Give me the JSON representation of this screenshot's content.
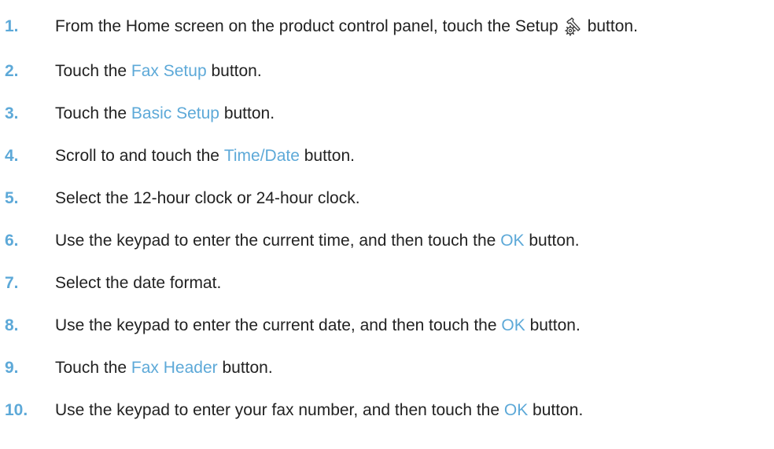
{
  "colors": {
    "step_number": "#5da9d8",
    "ui_label": "#5da9d8",
    "body_text": "#222222"
  },
  "steps": [
    {
      "number": "1.",
      "parts": [
        "From the Home screen on the product control panel, touch the Setup",
        "button."
      ],
      "icon": "setup-wrench-gear-icon"
    },
    {
      "number": "2.",
      "parts": [
        "Touch the ",
        "Fax Setup",
        " button."
      ]
    },
    {
      "number": "3.",
      "parts": [
        "Touch the ",
        "Basic Setup",
        " button."
      ]
    },
    {
      "number": "4.",
      "parts": [
        "Scroll to and touch the ",
        "Time/Date",
        " button."
      ]
    },
    {
      "number": "5.",
      "parts": [
        "Select the 12-hour clock or 24-hour clock."
      ]
    },
    {
      "number": "6.",
      "parts": [
        "Use the keypad to enter the current time, and then touch the ",
        "OK",
        " button."
      ]
    },
    {
      "number": "7.",
      "parts": [
        "Select the date format."
      ]
    },
    {
      "number": "8.",
      "parts": [
        "Use the keypad to enter the current date, and then touch the ",
        "OK",
        " button."
      ]
    },
    {
      "number": "9.",
      "parts": [
        "Touch the ",
        "Fax Header",
        " button."
      ]
    },
    {
      "number": "10.",
      "parts": [
        "Use the keypad to enter your fax number, and then touch the ",
        "OK",
        " button."
      ]
    }
  ]
}
